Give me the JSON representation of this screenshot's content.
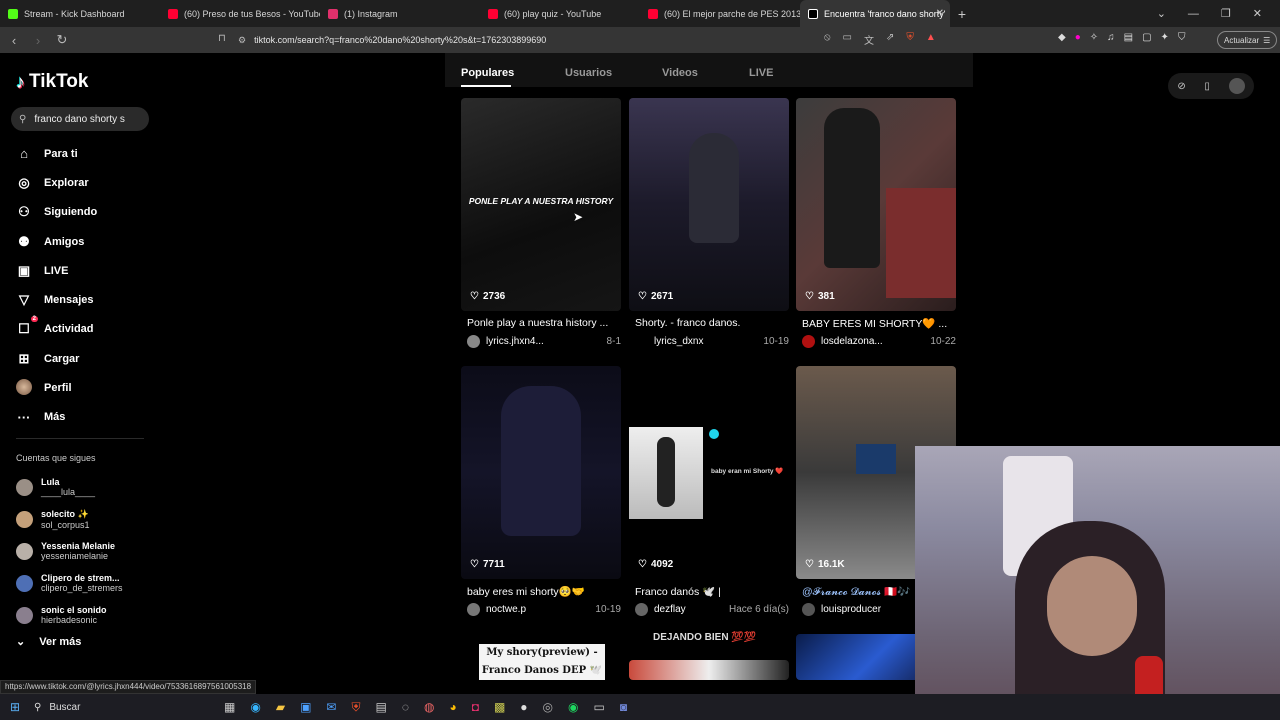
{
  "browser": {
    "tabs": [
      {
        "title": "Stream - Kick Dashboard",
        "color": "#53fc18"
      },
      {
        "title": "(60) Preso de tus Besos - YouTube",
        "color": "#ff0033"
      },
      {
        "title": "(1) Instagram",
        "color": "#e1306c"
      },
      {
        "title": "(60) play quiz - YouTube",
        "color": "#ff0033"
      },
      {
        "title": "(60) El mejor parche de PES 2013 ya",
        "color": "#ff0033"
      },
      {
        "title": "Encuentra 'franco dano shorty'",
        "color": "#ffffff"
      }
    ],
    "url": "tiktok.com/search?q=franco%20dano%20shorty%20s&t=1762303899690",
    "update_label": "Actualizar"
  },
  "sidebar": {
    "brand": "TikTok",
    "search_value": "franco dano shorty s",
    "nav": [
      {
        "label": "Para ti",
        "icon": "home-icon",
        "glyph": "⌂"
      },
      {
        "label": "Explorar",
        "icon": "compass-icon",
        "glyph": "◎"
      },
      {
        "label": "Siguiendo",
        "icon": "following-icon",
        "glyph": "⚇"
      },
      {
        "label": "Amigos",
        "icon": "friends-icon",
        "glyph": "⚉"
      },
      {
        "label": "LIVE",
        "icon": "live-icon",
        "glyph": "▣"
      },
      {
        "label": "Mensajes",
        "icon": "messages-icon",
        "glyph": "▽"
      },
      {
        "label": "Actividad",
        "icon": "activity-icon",
        "glyph": "☐",
        "badge": "2"
      },
      {
        "label": "Cargar",
        "icon": "upload-icon",
        "glyph": "⊞"
      },
      {
        "label": "Perfil",
        "icon": "profile-icon",
        "glyph": ""
      },
      {
        "label": "Más",
        "icon": "more-icon",
        "glyph": "···"
      }
    ],
    "following_title": "Cuentas que sigues",
    "following": [
      {
        "name": "Lula",
        "handle": "____lula____",
        "color": "#9a8f86"
      },
      {
        "name": "solecito ✨",
        "handle": "sol_corpus1",
        "color": "#c4a07a"
      },
      {
        "name": "Yessenia Melanie",
        "handle": "yesseniamelanie",
        "color": "#b9b0a8"
      },
      {
        "name": "Clipero de strem...",
        "handle": "clipero_de_stremers",
        "color": "#4e6fb5"
      },
      {
        "name": "sonic el sonido",
        "handle": "hierbadesonic",
        "color": "#8a7f8e"
      }
    ],
    "see_more": "Ver más"
  },
  "search_tabs": [
    "Populares",
    "Usuarios",
    "Videos",
    "LIVE"
  ],
  "results": [
    {
      "likes": "2736",
      "title": "Ponle play a nuestra history ...",
      "user": "lyrics.jhxn4...",
      "date": "8-1",
      "overlay": "PONLE PLAY A NUESTRA HISTORY",
      "avatar": "#888888"
    },
    {
      "likes": "2671",
      "title": "Shorty. - franco danos.",
      "user": "lyrics_dxnx",
      "date": "10-19",
      "overlay": "",
      "avatar": "#000000"
    },
    {
      "likes": "381",
      "title": "BABY ERES MI SHORTY🧡 ...",
      "user": "losdelazona...",
      "date": "10-22",
      "overlay": "",
      "avatar": "#b01010"
    },
    {
      "likes": "7711",
      "title": "baby eres mi shorty🥺🤝",
      "user": "noctwe.p",
      "date": "10-19",
      "overlay": "",
      "avatar": "#777777"
    },
    {
      "likes": "4092",
      "title": "Franco danós 🕊️ |",
      "user": "dezflay",
      "date": "Hace 6 día(s)",
      "overlay": "baby eran mi Shorty ❤️",
      "avatar": "#666666"
    },
    {
      "likes": "16.1K",
      "title": "@𝓕𝓻𝓪𝓷𝓬𝓸 𝓓𝓪𝓷𝓸𝓼 🇵🇪🎶",
      "user": "louisproducer",
      "date": "",
      "overlay": "",
      "avatar": "#555555"
    }
  ],
  "row3": {
    "left_caption": "My shory(preview) - Franco Danos DEP 🕊️",
    "mid_caption": "DEJANDO BIEN 💯💯"
  },
  "status_url": "https://www.tiktok.com/@lyrics.jhxn444/video/7533616897561005318",
  "taskbar": {
    "search_label": "Buscar"
  }
}
